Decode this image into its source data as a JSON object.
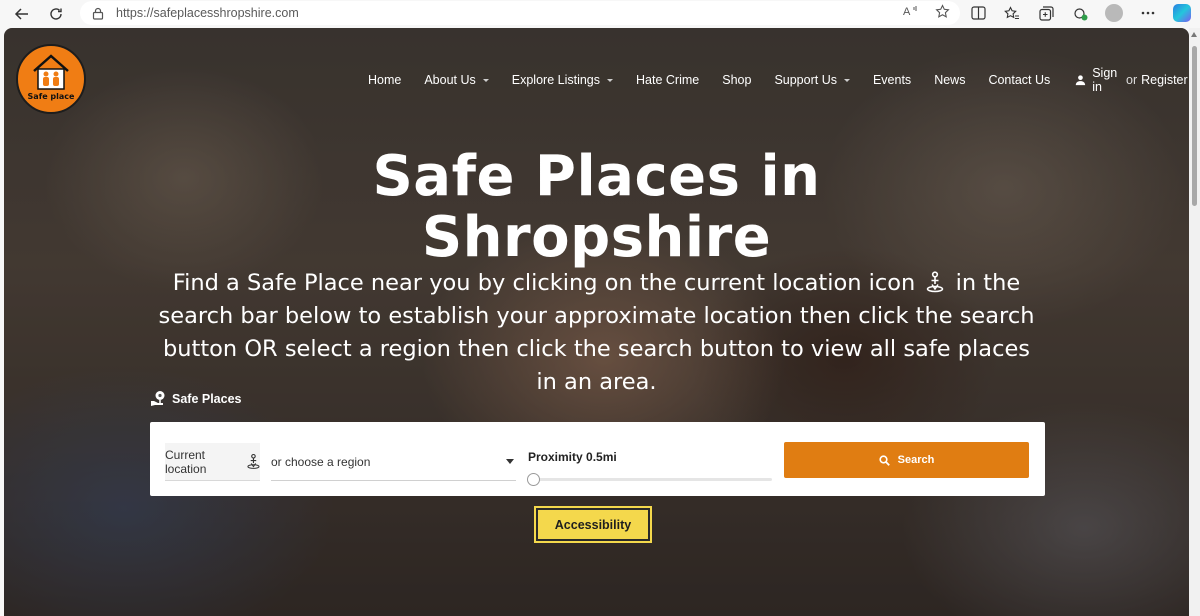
{
  "browser": {
    "url": "https://safeplacesshropshire.com"
  },
  "logo": {
    "caption": "Safe place"
  },
  "nav": {
    "items": [
      {
        "label": "Home",
        "dropdown": false
      },
      {
        "label": "About Us",
        "dropdown": true
      },
      {
        "label": "Explore Listings",
        "dropdown": true
      },
      {
        "label": "Hate Crime",
        "dropdown": false
      },
      {
        "label": "Shop",
        "dropdown": false
      },
      {
        "label": "Support Us",
        "dropdown": true
      },
      {
        "label": "Events",
        "dropdown": false
      },
      {
        "label": "News",
        "dropdown": false
      },
      {
        "label": "Contact Us",
        "dropdown": false
      }
    ],
    "sign_in": "Sign in",
    "or": "or",
    "register": "Register"
  },
  "hero": {
    "title_line1": "Safe Places in",
    "title_line2": "Shropshire",
    "subtitle_part1": "Find a Safe Place near you by clicking on the current location icon",
    "subtitle_part2": "in the search bar below to establish your approximate location then click the search button OR select a region then click the search button to view all safe places in an area."
  },
  "search": {
    "section_label": "Safe Places",
    "current_location": "Current location",
    "region_placeholder": "or choose a region",
    "proximity_label": "Proximity 0.5mi",
    "proximity_value": 0.0,
    "search_label": "Search",
    "accessibility_label": "Accessibility"
  },
  "colors": {
    "accent": "#e07d12",
    "accessibility": "#f4d84c",
    "logo": "#f07d14"
  }
}
